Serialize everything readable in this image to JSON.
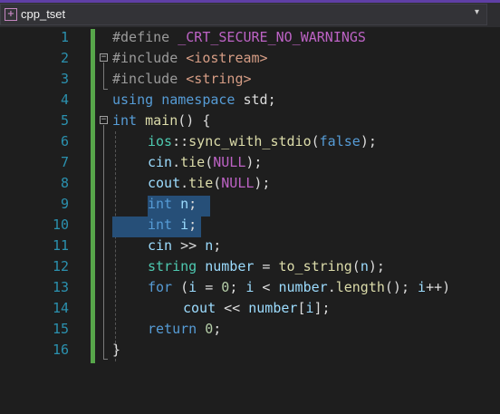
{
  "tab": {
    "title": "cpp_tset",
    "icon": "cpp-file-icon",
    "dropdown": "▾"
  },
  "editor": {
    "line_numbers": [
      "1",
      "2",
      "3",
      "4",
      "5",
      "6",
      "7",
      "8",
      "9",
      "10",
      "11",
      "12",
      "13",
      "14",
      "15",
      "16"
    ],
    "code": {
      "l1": {
        "directive": "#define",
        "macro": "_CRT_SECURE_NO_WARNINGS"
      },
      "l2": {
        "directive": "#include",
        "header": "<iostream>"
      },
      "l3": {
        "directive": "#include",
        "header": "<string>"
      },
      "l4": {
        "kw1": "using",
        "kw2": "namespace",
        "rest": " std;"
      },
      "l5": {
        "kw": "int",
        "fn": "main",
        "rest": "() {"
      },
      "l6": {
        "ns": "ios",
        "sep": "::",
        "fn": "sync_with_stdio",
        "open": "(",
        "kw": "false",
        "close": ");"
      },
      "l7": {
        "obj": "cin",
        "dot": ".",
        "fn": "tie",
        "open": "(",
        "macro": "NULL",
        "close": ");"
      },
      "l8": {
        "obj": "cout",
        "dot": ".",
        "fn": "tie",
        "open": "(",
        "macro": "NULL",
        "close": ");"
      },
      "l9": {
        "kw": "int",
        "var": "n",
        "semi": ";"
      },
      "l10": {
        "kw": "int",
        "var": "i",
        "semi": ";"
      },
      "l11": {
        "obj": "cin",
        "op": " >> ",
        "var": "n",
        "semi": ";"
      },
      "l12": {
        "type": "string",
        "var": "number",
        "op": " = ",
        "fn": "to_string",
        "open": "(",
        "arg": "n",
        "close": ");"
      },
      "l13": {
        "kw": "for",
        "p1": " (",
        "v1": "i",
        "p2": " = ",
        "n0": "0",
        "p3": "; ",
        "v2": "i",
        "p4": " < ",
        "v3": "number",
        "dot": ".",
        "fn": "length",
        "p5": "(); ",
        "v4": "i",
        "p6": "++)"
      },
      "l14": {
        "obj": "cout",
        "op": " << ",
        "var": "number",
        "b1": "[",
        "idx": "i",
        "b2": "];"
      },
      "l15": {
        "kw": "return",
        "num": "0",
        "semi": ";"
      },
      "l16": {
        "brace": "}"
      }
    }
  },
  "colors": {
    "keyword": "#569cd6",
    "function": "#dcdcaa",
    "string": "#d69d85",
    "macro": "#bd63c5",
    "variable": "#9cdcfe",
    "namespace": "#4ec9b0",
    "number": "#b5cea8",
    "line_number": "#2b91af",
    "change_bar": "#57a64a",
    "selection": "#264f78"
  }
}
